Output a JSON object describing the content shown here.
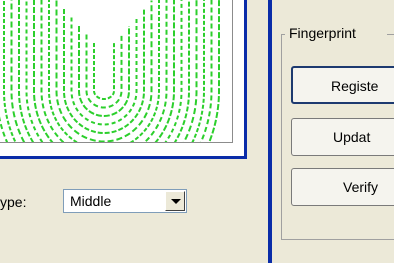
{
  "fingerprint_group": {
    "title": "Fingerprint",
    "buttons": {
      "register": "Registe",
      "update": "Updat",
      "verify": "Verify"
    }
  },
  "finger_type": {
    "label": "ype:",
    "selected": "Middle"
  },
  "colors": {
    "fingerprint_ridges": "#2ccf2c",
    "frame_border": "#0a2ca8",
    "window_bg": "#ece9d8"
  }
}
